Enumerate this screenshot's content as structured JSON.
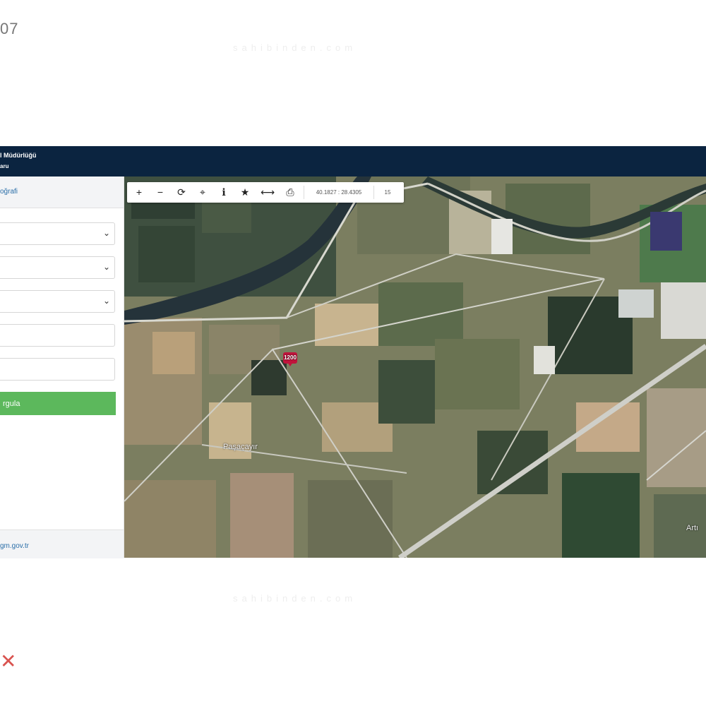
{
  "page": {
    "listing_number": "07",
    "watermark": "sahibinden.com"
  },
  "app": {
    "header_title": "l Müdürlüğü",
    "header_subtitle": "aru"
  },
  "sidebar": {
    "tab_label": "oğrafi",
    "select_fields": [
      {
        "value": "",
        "icon": "chevron-down-icon"
      },
      {
        "value": "",
        "icon": "chevron-down-icon"
      },
      {
        "value": "",
        "icon": "chevron-down-icon"
      }
    ],
    "input_fields": [
      {
        "value": ""
      },
      {
        "value": ""
      }
    ],
    "verify_button_label": "rgula",
    "footer_link": "gm.gov.tr"
  },
  "map": {
    "toolbar": {
      "tools": [
        {
          "name": "zoom-in-icon",
          "glyph": "+"
        },
        {
          "name": "zoom-out-icon",
          "glyph": "−"
        },
        {
          "name": "refresh-icon",
          "glyph": "⟳"
        },
        {
          "name": "locate-icon",
          "glyph": "⌖"
        },
        {
          "name": "info-icon",
          "glyph": "ℹ"
        },
        {
          "name": "star-icon",
          "glyph": "★"
        },
        {
          "name": "measure-icon",
          "glyph": "⟷"
        },
        {
          "name": "print-icon",
          "glyph": "⎙"
        }
      ],
      "coordinates": "40.1827 : 28.4305",
      "zoom_level": "15"
    },
    "marker_label": "1200",
    "place_labels": [
      "Paşaçayır",
      "Artı"
    ],
    "colors": {
      "header_bg": "#0b2440",
      "button_green": "#5cb85c",
      "marker_red": "#c0143c",
      "link_blue": "#2a6ea8"
    }
  }
}
